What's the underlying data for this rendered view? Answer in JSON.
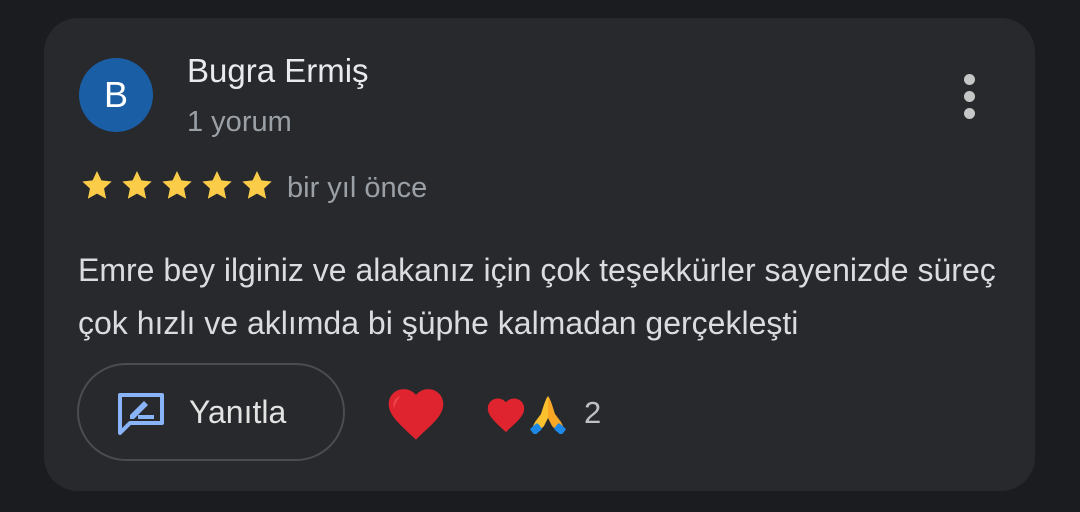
{
  "review": {
    "avatar_letter": "B",
    "author_name": "Bugra Ermiş",
    "review_count": "1 yorum",
    "rating": 5,
    "time": "bir yıl önce",
    "text": "Emre bey ilginiz ve alakanız için çok teşekkürler sayenizde süreç çok hızlı ve aklımda bi şüphe kalmadan gerçekleşti"
  },
  "actions": {
    "reply_label": "Yanıtla",
    "reaction_count": "2",
    "reaction_icons": [
      "heart-icon",
      "praying-hands-icon"
    ]
  },
  "colors": {
    "background": "#1b1c1f",
    "card": "#28292c",
    "avatar": "#1a5ea6",
    "star": "#fbcc47",
    "heart": "#e0242f",
    "reply_icon": "#8ab4f8"
  }
}
